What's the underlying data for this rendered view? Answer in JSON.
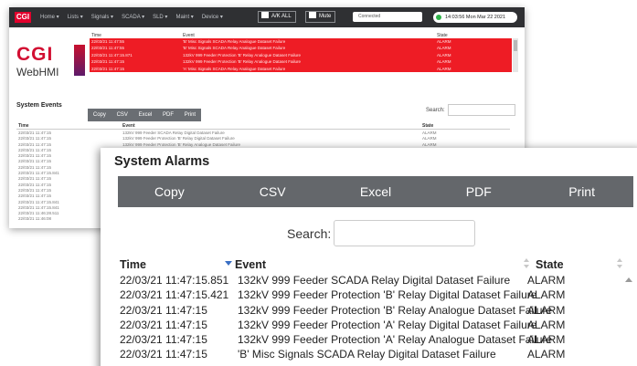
{
  "back_window": {
    "nav": {
      "logo": "CGI",
      "menus": [
        "Home ▾",
        "Lists ▾",
        "Signals ▾",
        "SCADA ▾",
        "SLD ▾",
        "Maint ▾",
        "Device ▾"
      ],
      "ack_label": "A/K ALL",
      "mute_label": "Mute",
      "conn_value": "Connected",
      "datetime": "14:03:56 Mon Mar 22 2021"
    },
    "logo": {
      "cgi": "CGI",
      "webhmi": "WebHMI"
    },
    "alarm_table": {
      "headers": {
        "time": "Time",
        "event": "Event",
        "state": "State"
      },
      "rows": [
        {
          "time": "22/03/21 11:47:55",
          "event": "'B' Misc Signals SCADA Relay Analogue Dataset Failure",
          "state": "ALARM"
        },
        {
          "time": "22/03/21 11:47:55",
          "event": "'B' Misc Signals SCADA Relay Analogue Dataset Failure",
          "state": "ALARM"
        },
        {
          "time": "22/03/21 11:47:15.871",
          "event": "132kV 999 Feeder Protection 'B' Relay Analogue Dataset Failure",
          "state": "ALARM"
        },
        {
          "time": "22/03/21 11:47:15",
          "event": "132kV 999 Feeder Protection 'B' Relay Analogue Dataset Failure",
          "state": "ALARM"
        },
        {
          "time": "22/03/21 11:47:15",
          "event": "'A' Misc Signals SCADA Relay Analogue Dataset Failure",
          "state": "ALARM"
        }
      ]
    },
    "system_events": {
      "title": "System Events",
      "buttons": [
        "Copy",
        "CSV",
        "Excel",
        "PDF",
        "Print"
      ],
      "search_label": "Search:",
      "headers": {
        "time": "Time",
        "event": "Event",
        "state": "State"
      },
      "rows": [
        {
          "time": "22/03/21 11:47:15",
          "event": "132kV 999 Feeder SCADA Relay Digital Dataset Failure",
          "state": "ALARM"
        },
        {
          "time": "22/03/21 11:47:15",
          "event": "132kV 999 Feeder Protection 'B' Relay Digital Dataset Failure",
          "state": "ALARM"
        },
        {
          "time": "22/03/21 11:47:15",
          "event": "132kV 999 Feeder Protection 'B' Relay Analogue Dataset Failure",
          "state": "ALARM"
        },
        {
          "time": "22/03/21 11:47:15",
          "event": "",
          "state": ""
        },
        {
          "time": "22/03/21 11:47:15",
          "event": "",
          "state": ""
        },
        {
          "time": "22/03/21 11:47:15",
          "event": "",
          "state": ""
        },
        {
          "time": "22/03/21 11:47:15",
          "event": "",
          "state": ""
        },
        {
          "time": "22/03/21 11:47:15.841",
          "event": "",
          "state": ""
        },
        {
          "time": "22/03/21 11:47:15",
          "event": "",
          "state": ""
        },
        {
          "time": "22/03/21 11:47:15",
          "event": "",
          "state": ""
        },
        {
          "time": "22/03/21 11:47:15",
          "event": "",
          "state": ""
        },
        {
          "time": "22/03/21 11:47:15",
          "event": "",
          "state": ""
        },
        {
          "time": "22/03/21 11:47:15.841",
          "event": "",
          "state": ""
        },
        {
          "time": "22/03/21 11:47:15.841",
          "event": "",
          "state": ""
        },
        {
          "time": "22/03/21 11:46:28.511",
          "event": "",
          "state": ""
        },
        {
          "time": "22/03/21 11:46:08",
          "event": "",
          "state": ""
        }
      ]
    }
  },
  "front_window": {
    "title": "System Alarms",
    "buttons": [
      "Copy",
      "CSV",
      "Excel",
      "PDF",
      "Print"
    ],
    "search_label": "Search:",
    "search_value": "",
    "headers": {
      "time": "Time",
      "event": "Event",
      "state": "State"
    },
    "rows": [
      {
        "time": "22/03/21 11:47:15.851",
        "event": "132kV 999 Feeder SCADA Relay Digital Dataset Failure",
        "state": "ALARM"
      },
      {
        "time": "22/03/21 11:47:15.421",
        "event": "132kV 999 Feeder Protection 'B' Relay Digital Dataset Failure",
        "state": "ALARM"
      },
      {
        "time": "22/03/21 11:47:15",
        "event": "132kV 999 Feeder Protection 'B' Relay Analogue Dataset Failure",
        "state": "ALARM"
      },
      {
        "time": "22/03/21 11:47:15",
        "event": "132kV 999 Feeder Protection 'A' Relay Digital Dataset Failure",
        "state": "ALARM"
      },
      {
        "time": "22/03/21 11:47:15",
        "event": "132kV 999 Feeder Protection 'A' Relay Analogue Dataset Failure",
        "state": "ALARM"
      },
      {
        "time": "22/03/21 11:47:15",
        "event": "'B' Misc Signals SCADA Relay Digital Dataset Failure",
        "state": "ALARM"
      }
    ]
  },
  "colors": {
    "alarm_red": "#ee1c25",
    "navbar": "#2f3033",
    "toolbar": "#64676b",
    "brand_red": "#d20f32",
    "status_green": "#2fb34a"
  }
}
